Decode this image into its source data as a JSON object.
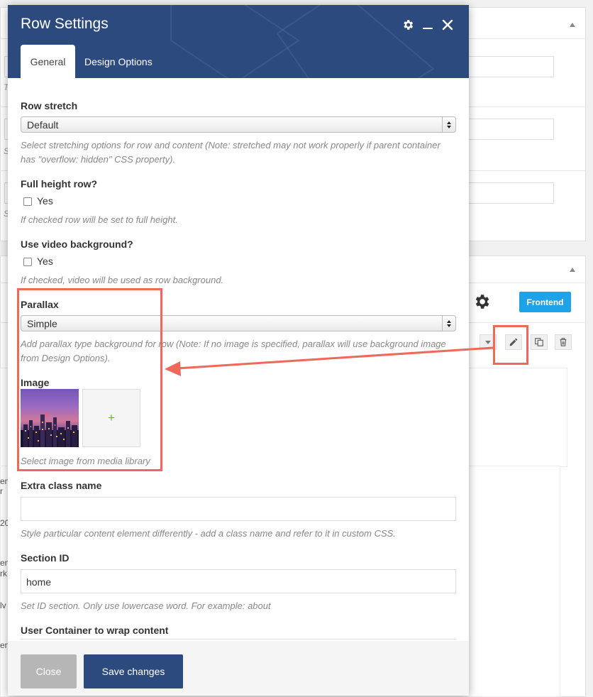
{
  "modal": {
    "title": "Row Settings",
    "icons": {
      "settings": "gear-icon",
      "minimize": "minimize-icon",
      "close": "close-icon"
    },
    "tabs": [
      {
        "label": "General",
        "active": true
      },
      {
        "label": "Design Options",
        "active": false
      }
    ],
    "fields": {
      "row_stretch": {
        "label": "Row stretch",
        "value": "Default",
        "hint": "Select stretching options for row and content (Note: stretched may not work properly if parent container has \"overflow: hidden\" CSS property)."
      },
      "full_height": {
        "label": "Full height row?",
        "checkbox_label": "Yes",
        "checked": false,
        "hint": "If checked row will be set to full height."
      },
      "video_bg": {
        "label": "Use video background?",
        "checkbox_label": "Yes",
        "checked": false,
        "hint": "If checked, video will be used as row background."
      },
      "parallax": {
        "label": "Parallax",
        "value": "Simple",
        "hint": "Add parallax type background for row (Note: If no image is specified, parallax will use background image from Design Options)."
      },
      "image": {
        "label": "Image",
        "remove_glyph": "×",
        "add_glyph": "+",
        "hint": "Select image from media library"
      },
      "extra_class": {
        "label": "Extra class name",
        "value": "",
        "hint": "Style particular content element differently - add a class name and refer to it in custom CSS."
      },
      "section_id": {
        "label": "Section ID",
        "value": "home",
        "hint": "Set ID section. Only use lowercase word. For example: about"
      },
      "container": {
        "label": "User Container to wrap content"
      }
    },
    "buttons": {
      "close": "Close",
      "save": "Save changes"
    }
  },
  "background": {
    "frontend_button": "Frontend",
    "left_fragments": [
      "en",
      "r",
      "20",
      "en",
      "rk",
      "lv",
      "en"
    ],
    "hint_fragments": [
      "T",
      "S",
      "S"
    ]
  },
  "colors": {
    "modal_header": "#2d4a7f",
    "save_button": "#2d4a7f",
    "close_button": "#b6b6b6",
    "highlight": "#f0685a",
    "frontend_button": "#1fa3e8"
  }
}
